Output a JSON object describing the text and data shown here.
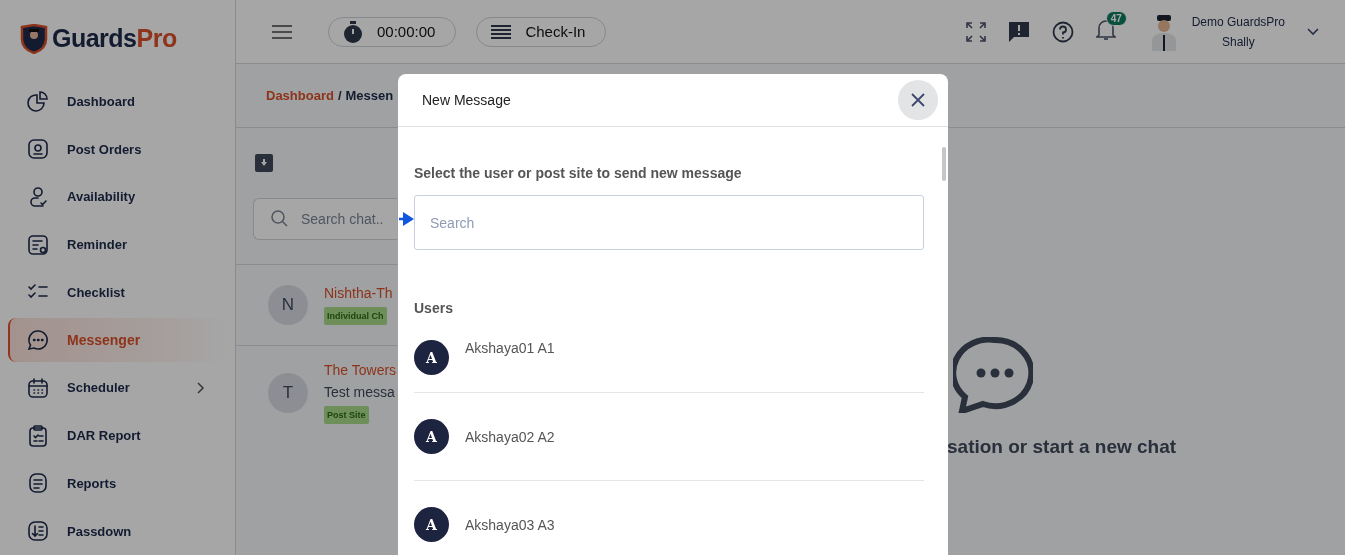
{
  "logo": {
    "text_main": "Guards",
    "text_accent": "Pro"
  },
  "sidebar": {
    "items": [
      {
        "label": "Dashboard",
        "selected": false,
        "expandable": false
      },
      {
        "label": "Post Orders",
        "selected": false,
        "expandable": false
      },
      {
        "label": "Availability",
        "selected": false,
        "expandable": false
      },
      {
        "label": "Reminder",
        "selected": false,
        "expandable": false
      },
      {
        "label": "Checklist",
        "selected": false,
        "expandable": false
      },
      {
        "label": "Messenger",
        "selected": true,
        "expandable": false
      },
      {
        "label": "Scheduler",
        "selected": false,
        "expandable": true
      },
      {
        "label": "DAR Report",
        "selected": false,
        "expandable": false
      },
      {
        "label": "Reports",
        "selected": false,
        "expandable": false
      },
      {
        "label": "Passdown",
        "selected": false,
        "expandable": false
      }
    ]
  },
  "header": {
    "timer": "00:00:00",
    "check_in": "Check-In",
    "notifications": "47",
    "user": {
      "name": "Demo GuardsPro",
      "subtitle": "Shally"
    }
  },
  "breadcrumb": {
    "parent": "Dashboard",
    "separator": "/",
    "current": "Messen"
  },
  "chat_search": {
    "placeholder": "Search chat.."
  },
  "chats": [
    {
      "initial": "N",
      "name": "Nishtha-Th",
      "tag": "Individual Ch"
    },
    {
      "initial": "T",
      "name": "The Towers",
      "preview": "Test messa",
      "tag": "Post Site"
    }
  ],
  "empty_state": {
    "text": "sation or start a new chat"
  },
  "modal": {
    "title": "New Message",
    "prompt": "Select the user or post site to send new message",
    "search": {
      "placeholder": "Search"
    },
    "section": "Users",
    "users": [
      {
        "initial": "A",
        "name": "Akshaya01 A1"
      },
      {
        "initial": "A",
        "name": "Akshaya02 A2"
      },
      {
        "initial": "A",
        "name": "Akshaya03 A3"
      }
    ]
  }
}
